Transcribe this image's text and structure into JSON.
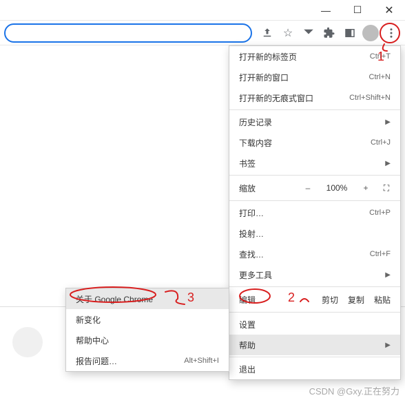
{
  "window": {
    "minimize": "—",
    "maximize": "☐",
    "close": "✕"
  },
  "toolbar": {
    "share": "share-icon",
    "star": "☆",
    "profile": "profile-icon"
  },
  "main_menu": {
    "new_tab": {
      "label": "打开新的标签页",
      "shortcut": "Ctrl+T"
    },
    "new_window": {
      "label": "打开新的窗口",
      "shortcut": "Ctrl+N"
    },
    "incognito": {
      "label": "打开新的无痕式窗口",
      "shortcut": "Ctrl+Shift+N"
    },
    "history": {
      "label": "历史记录"
    },
    "downloads": {
      "label": "下载内容",
      "shortcut": "Ctrl+J"
    },
    "bookmarks": {
      "label": "书签"
    },
    "zoom": {
      "label": "缩放",
      "minus": "–",
      "value": "100%",
      "plus": "+",
      "full": "⛶"
    },
    "print": {
      "label": "打印…",
      "shortcut": "Ctrl+P"
    },
    "cast": {
      "label": "投射…"
    },
    "find": {
      "label": "查找…",
      "shortcut": "Ctrl+F"
    },
    "more_tools": {
      "label": "更多工具"
    },
    "edit": {
      "label": "编辑",
      "cut": "剪切",
      "copy": "复制",
      "paste": "粘贴"
    },
    "settings": {
      "label": "设置"
    },
    "help": {
      "label": "帮助"
    },
    "exit": {
      "label": "退出"
    }
  },
  "help_submenu": {
    "about": "关于 Google Chrome",
    "whats_new": "新变化",
    "help_center": "帮助中心",
    "report": {
      "label": "报告问题…",
      "shortcut": "Alt+Shift+I"
    }
  },
  "annotations": {
    "n1": "1",
    "n2": "2",
    "n3": "3"
  },
  "watermark": "CSDN @Gxy.正在努力"
}
